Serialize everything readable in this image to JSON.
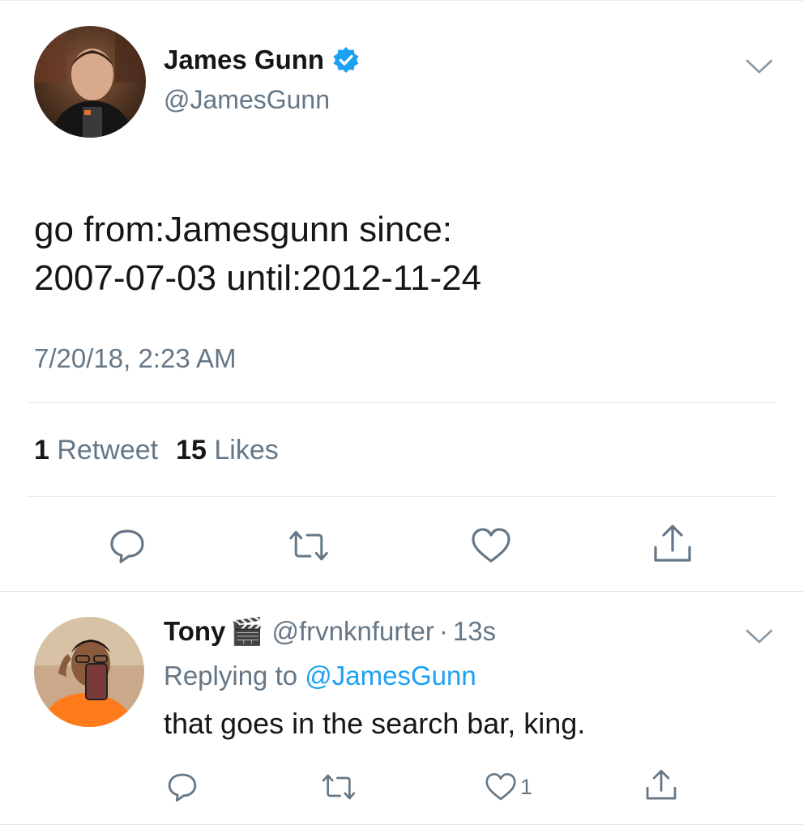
{
  "tweet": {
    "author_name": "James Gunn",
    "author_handle": "@JamesGunn",
    "verified": true,
    "text_line1": "go from:Jamesgunn since:",
    "text_line2": "2007-07-03 until:2012-11-24",
    "timestamp": "7/20/18, 2:23 AM",
    "retweet_count": "1",
    "retweet_label": "Retweet",
    "like_count": "15",
    "like_label": "Likes",
    "actions": [
      "reply-icon",
      "retweet-icon",
      "heart-icon",
      "share-icon"
    ]
  },
  "reply": {
    "author_name": "Tony",
    "emoji": "🎬",
    "author_handle": "@frvnknfurter",
    "separator": "·",
    "time_ago": "13s",
    "replying_prefix": "Replying to",
    "replying_mention": "@JamesGunn",
    "text": "that goes in the search bar, king.",
    "like_count": "1",
    "actions": [
      "reply-icon",
      "retweet-icon",
      "heart-icon",
      "share-icon"
    ]
  },
  "colors": {
    "accent": "#1da1f2",
    "secondary_text": "#657786",
    "primary_text": "#14171a",
    "divider": "#e1e8ed"
  }
}
